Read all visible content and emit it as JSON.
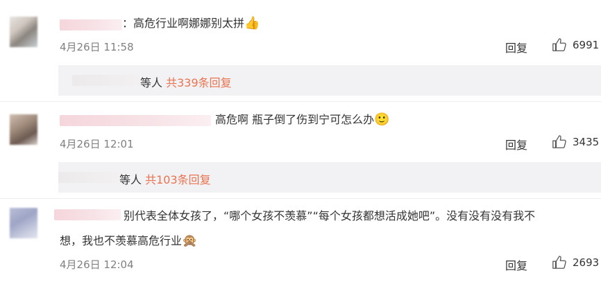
{
  "comments": [
    {
      "text_prefix": "：",
      "text": "高危行业啊娜娜别太拼",
      "emoji": "👍",
      "date": "4月26日 11:58",
      "reply_label": "回复",
      "likes": "6991",
      "reply_summary": {
        "suffix": "等人",
        "count_text": "共339条回复"
      }
    },
    {
      "text": "高危啊 瓶子倒了伤到宁可怎么办",
      "emoji": "🙂",
      "date": "4月26日 12:01",
      "reply_label": "回复",
      "likes": "3435",
      "reply_summary": {
        "suffix": "等人",
        "count_text": "共103条回复"
      }
    },
    {
      "text_line1": "别代表全体女孩了，“哪个女孩不羡慕”“每个女孩都想活成她吧”。没有没有没有我不",
      "text_line2": "想，我也不羡慕高危行业",
      "emoji": "🙊",
      "date": "4月26日 12:04",
      "reply_label": "回复",
      "likes": "2693"
    }
  ]
}
